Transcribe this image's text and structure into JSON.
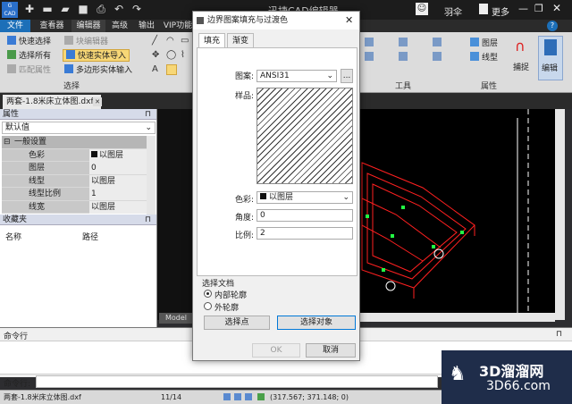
{
  "app": {
    "title": "迅捷CAD编辑器",
    "user": "羽伞",
    "more": "更多"
  },
  "menu": [
    "文件",
    "查看器",
    "编辑器",
    "高级",
    "输出",
    "VIP功能"
  ],
  "ribbon": {
    "select_group": {
      "items": [
        "快速选择",
        "选择所有",
        "匹配属性",
        "块编辑器",
        "快速实体导入",
        "多边形实体输入"
      ],
      "label": "选择"
    },
    "tools_label": "工具",
    "props_group": {
      "items": [
        "图层",
        "线型"
      ],
      "label": "属性"
    },
    "snap": "捕捉",
    "edit": "编辑"
  },
  "doc_tab": "两套-1.8米床立体图.dxf",
  "properties": {
    "title": "属性",
    "dropdown": "默认值",
    "section": "一般设置",
    "rows": [
      {
        "k": "色彩",
        "v": "以图层"
      },
      {
        "k": "图层",
        "v": "0"
      },
      {
        "k": "线型",
        "v": "以图层"
      },
      {
        "k": "线型比例",
        "v": "1"
      },
      {
        "k": "线宽",
        "v": "以图层"
      }
    ]
  },
  "favorites": {
    "title": "收藏夹",
    "col_name": "名称",
    "col_path": "路径"
  },
  "model_tab": "Model",
  "cmd": {
    "title": "命令行",
    "prompt": "命令行:"
  },
  "status": {
    "file": "两套-1.8米床立体图.dxf",
    "page": "11/14",
    "coords": "(317.567; 371.148; 0)"
  },
  "dialog": {
    "title": "边界图案填充与过渡色",
    "tabs": [
      "填充",
      "渐变"
    ],
    "pattern_label": "图案:",
    "pattern_value": "ANSI31",
    "pattern_browse": "...",
    "sample_label": "样品:",
    "color_label": "色彩:",
    "color_value": "以图层",
    "angle_label": "角度:",
    "angle_value": "0",
    "scale_label": "比例:",
    "scale_value": "2",
    "select_doc": "选择文档",
    "inner": "内部轮廓",
    "outer": "外轮廓",
    "pick_point": "选择点",
    "pick_object": "选择对象",
    "ok": "OK",
    "cancel": "取消"
  },
  "watermark": {
    "cn": "3D溜溜网",
    "en": "3D66.com"
  },
  "colors": {
    "accent": "#1c6fb8",
    "cad_red": "#ff2020",
    "cad_green": "#22ff44"
  }
}
